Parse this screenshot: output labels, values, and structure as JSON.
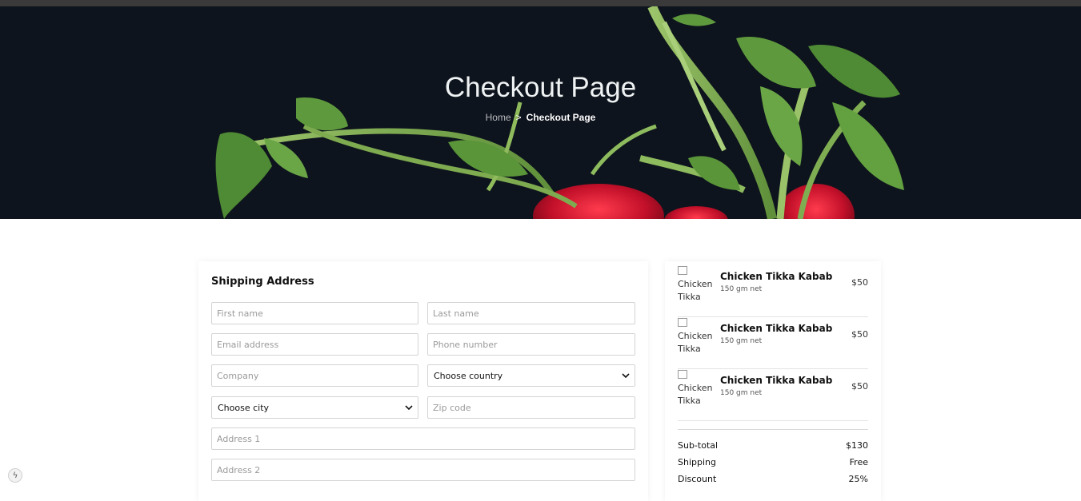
{
  "hero": {
    "title": "Checkout Page",
    "breadcrumb": {
      "home": "Home",
      "separator": ">",
      "current": "Checkout Page"
    }
  },
  "shipping": {
    "title": "Shipping Address",
    "first_name_placeholder": "First name",
    "last_name_placeholder": "Last name",
    "email_placeholder": "Email address",
    "phone_placeholder": "Phone number",
    "company_placeholder": "Company",
    "country_selected": "Choose country",
    "city_selected": "Choose city",
    "zip_placeholder": "Zip code",
    "address1_placeholder": "Address 1",
    "address2_placeholder": "Address 2"
  },
  "cart": {
    "items": [
      {
        "image_alt": "Chicken Tikka",
        "name": "Chicken Tikka Kabab",
        "net": "150 gm net",
        "price": "$50"
      },
      {
        "image_alt": "Chicken Tikka",
        "name": "Chicken Tikka Kabab",
        "net": "150 gm net",
        "price": "$50"
      },
      {
        "image_alt": "Chicken Tikka",
        "name": "Chicken Tikka Kabab",
        "net": "150 gm net",
        "price": "$50"
      }
    ],
    "summary": {
      "subtotal_label": "Sub-total",
      "subtotal_value": "$130",
      "shipping_label": "Shipping",
      "shipping_value": "Free",
      "discount_label": "Discount",
      "discount_value": "25%"
    }
  },
  "icons": {
    "dev_badge": "lightning-icon",
    "select_arrow": "chevron-down-icon"
  },
  "colors": {
    "hero_bg": "#0e141d",
    "top_bar": "#3a3a3a",
    "border": "#d4d4d4"
  }
}
